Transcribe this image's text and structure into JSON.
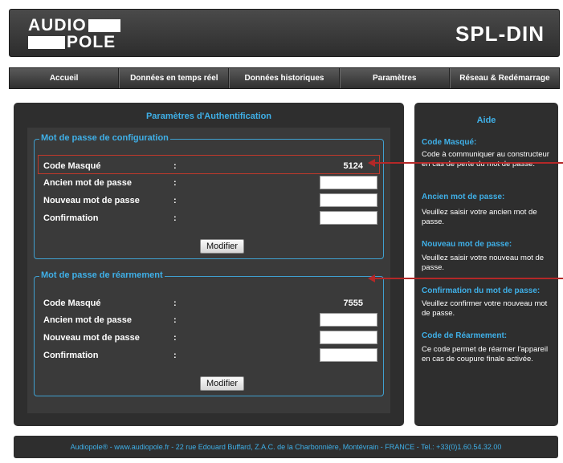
{
  "header": {
    "logo_line1": "AUDIO",
    "logo_line2": "POLE",
    "product": "SPL-DIN"
  },
  "nav": [
    {
      "label": "Accueil"
    },
    {
      "label": "Données en temps réel"
    },
    {
      "label": "Données historiques"
    },
    {
      "label": "Paramètres"
    },
    {
      "label": "Réseau & Redémarrage"
    }
  ],
  "main": {
    "title": "Paramètres d'Authentification",
    "config": {
      "legend": "Mot de passe de configuration",
      "rows": [
        {
          "label": "Code Masqué",
          "colon": ":",
          "value": "5124"
        },
        {
          "label": "Ancien mot de passe",
          "colon": ":",
          "input_value": ""
        },
        {
          "label": "Nouveau mot de passe",
          "colon": ":",
          "input_value": ""
        },
        {
          "label": "Confirmation",
          "colon": ":",
          "input_value": ""
        }
      ],
      "button": "Modifier"
    },
    "reset": {
      "legend": "Mot de passe de réarmement",
      "rows": [
        {
          "label": "Code Masqué",
          "colon": ":",
          "value": "7555"
        },
        {
          "label": "Ancien mot de passe",
          "colon": ":",
          "input_value": ""
        },
        {
          "label": "Nouveau mot de passe",
          "colon": ":",
          "input_value": ""
        },
        {
          "label": "Confirmation",
          "colon": ":",
          "input_value": ""
        }
      ],
      "button": "Modifier"
    }
  },
  "help": {
    "title": "Aide",
    "sections": [
      {
        "heading": "Code Masqué:",
        "text": "Code à communiquer au constructeur en cas de perte du mot de passe."
      },
      {
        "heading": "Ancien mot de passe:",
        "text": "Veuillez saisir votre ancien mot de passe."
      },
      {
        "heading": "Nouveau mot de passe:",
        "text": "Veuillez saisir votre nouveau mot de passe."
      },
      {
        "heading": "Confirmation du mot de passe:",
        "text": "Veuillez confirmer votre nouveau mot de passe."
      },
      {
        "heading": "Code de Réarmement:",
        "text": "Ce code permet de réarmer l'appareil en cas de coupure finale activée."
      }
    ]
  },
  "footer": {
    "text": "Audiopole® - www.audiopole.fr - 22 rue Edouard Buffard, Z.A.C. de la Charbonnière, Montévrain - FRANCE - Tel.: +33(0)1.60.54.32.00"
  },
  "colors": {
    "accent": "#3fb0e8",
    "panel": "#2e2e2e",
    "annotation": "#b42828"
  }
}
